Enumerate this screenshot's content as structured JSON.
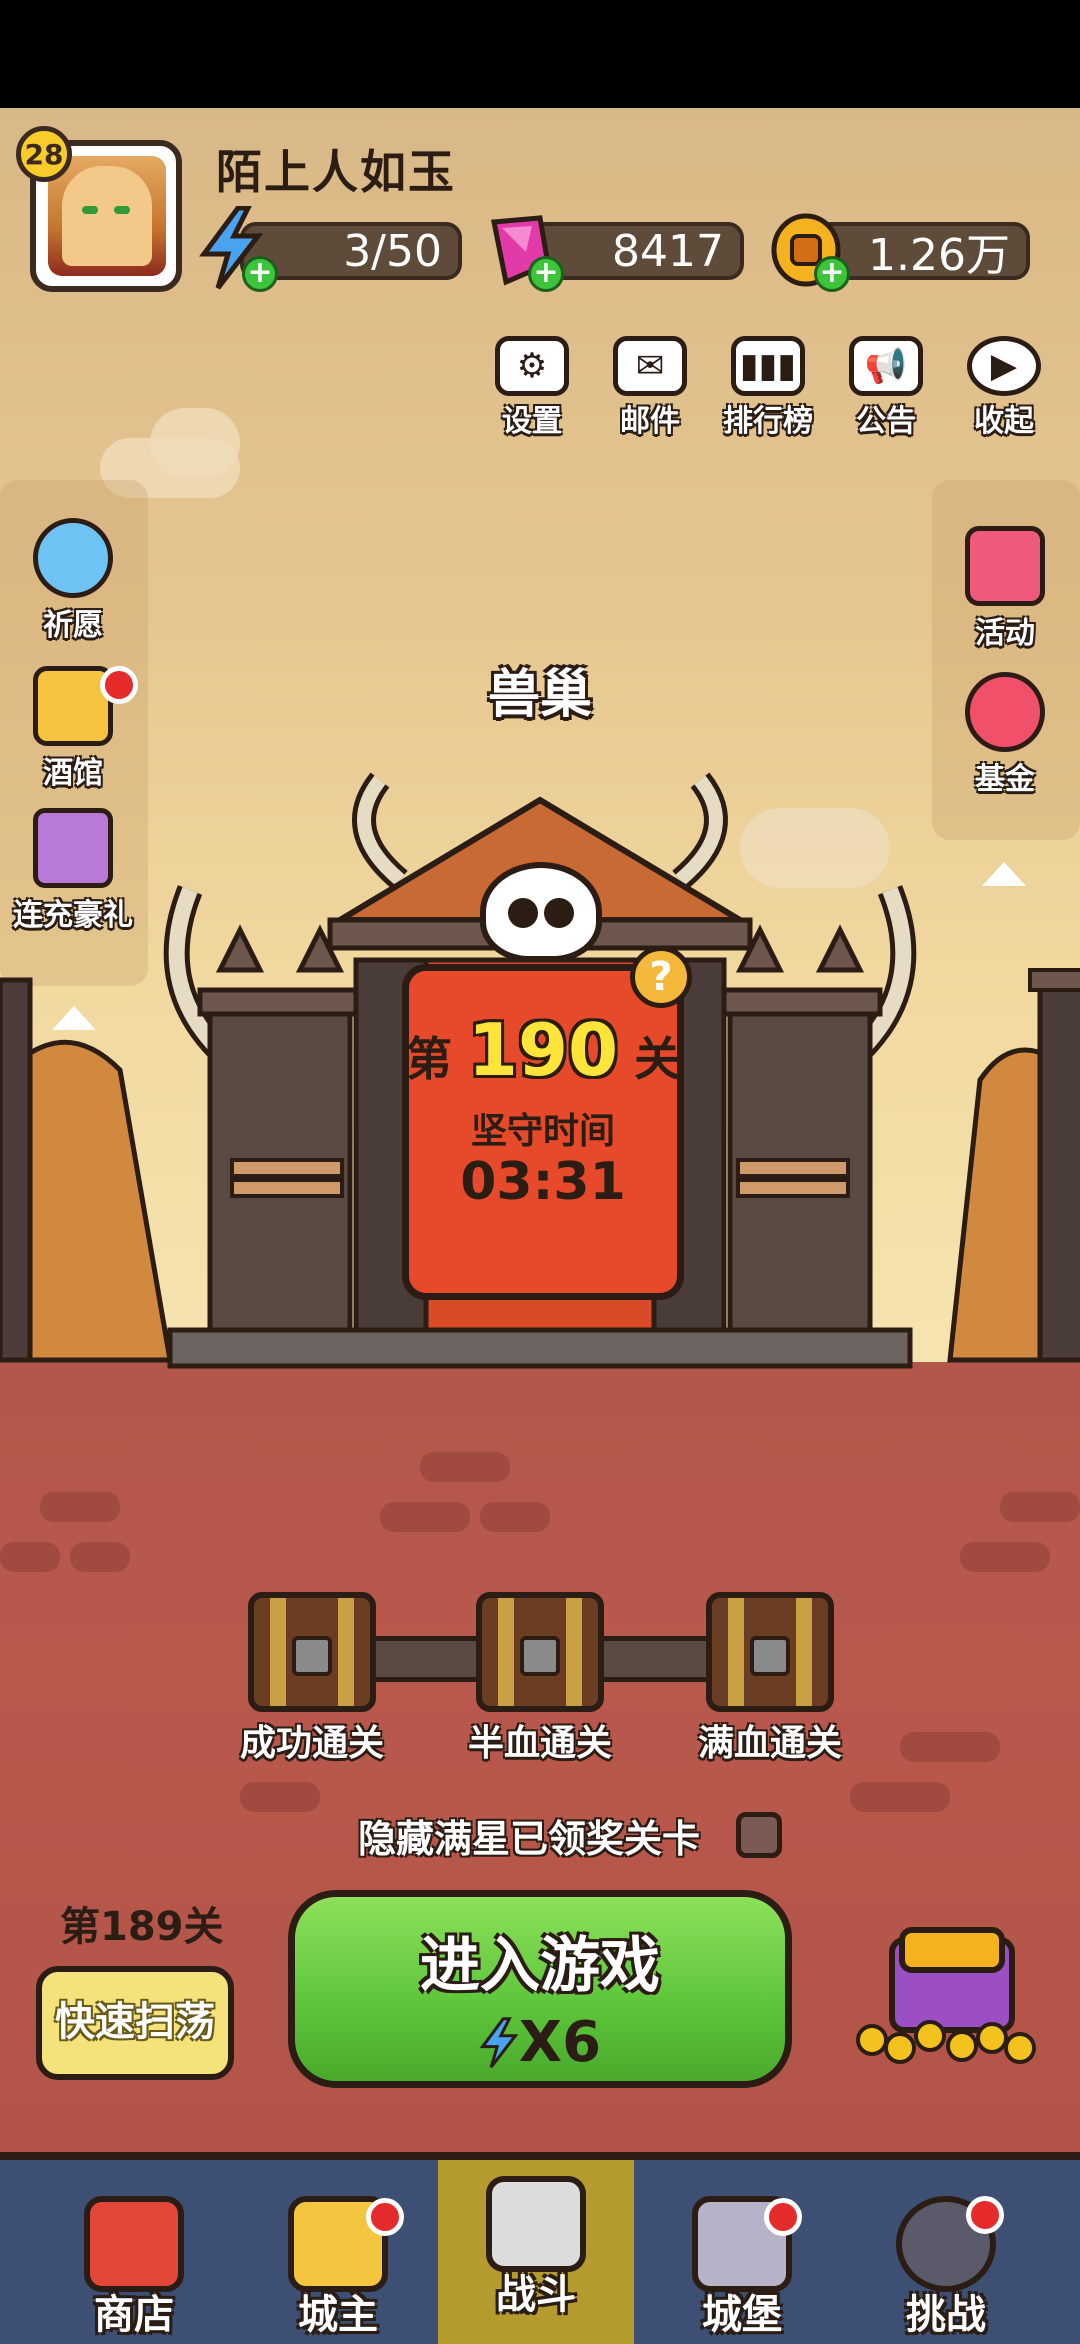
{
  "player": {
    "level": "28",
    "name": "陌上人如玉"
  },
  "resources": {
    "energy": "3/50",
    "gems": "8417",
    "gold": "1.26万"
  },
  "top_menu": [
    {
      "label": "设置",
      "icon": "gear-icon"
    },
    {
      "label": "邮件",
      "icon": "mail-icon"
    },
    {
      "label": "排行榜",
      "icon": "leaderboard-icon"
    },
    {
      "label": "公告",
      "icon": "megaphone-icon"
    },
    {
      "label": "收起",
      "icon": "collapse-icon"
    }
  ],
  "left_menu": [
    {
      "label": "祈愿",
      "icon": "wish-star-icon"
    },
    {
      "label": "酒馆",
      "icon": "tavern-beer-icon"
    },
    {
      "label": "连充豪礼",
      "icon": "gift-box-icon"
    }
  ],
  "right_menu": [
    {
      "label": "活动",
      "icon": "event-icon"
    },
    {
      "label": "基金",
      "icon": "fund-bag-icon"
    }
  ],
  "stage": {
    "area_name": "兽巢",
    "prefix": "第",
    "number": "190",
    "suffix": "关",
    "defend_label": "坚守时间",
    "defend_time": "03:31"
  },
  "chests": [
    {
      "label": "成功通关"
    },
    {
      "label": "半血通关"
    },
    {
      "label": "满血通关"
    }
  ],
  "hidden_toggle_label": "隐藏满星已领奖关卡",
  "sweep": {
    "last_stage": "第189关",
    "button": "快速扫荡"
  },
  "enter": {
    "label": "进入游戏",
    "cost": "X6"
  },
  "nav": [
    {
      "label": "商店",
      "icon": "shop-icon",
      "badge": false
    },
    {
      "label": "城主",
      "icon": "crown-icon",
      "badge": true
    },
    {
      "label": "战斗",
      "icon": "crossed-swords-icon",
      "badge": false,
      "active": true
    },
    {
      "label": "城堡",
      "icon": "castle-icon",
      "badge": true
    },
    {
      "label": "挑战",
      "icon": "demon-icon",
      "badge": true
    }
  ],
  "colors": {
    "accent_green": "#5cc53a",
    "ground": "#b2574a",
    "nav_bg": "#3d4f72",
    "nav_active": "#b59a2e",
    "sign_red": "#e64a2a"
  }
}
